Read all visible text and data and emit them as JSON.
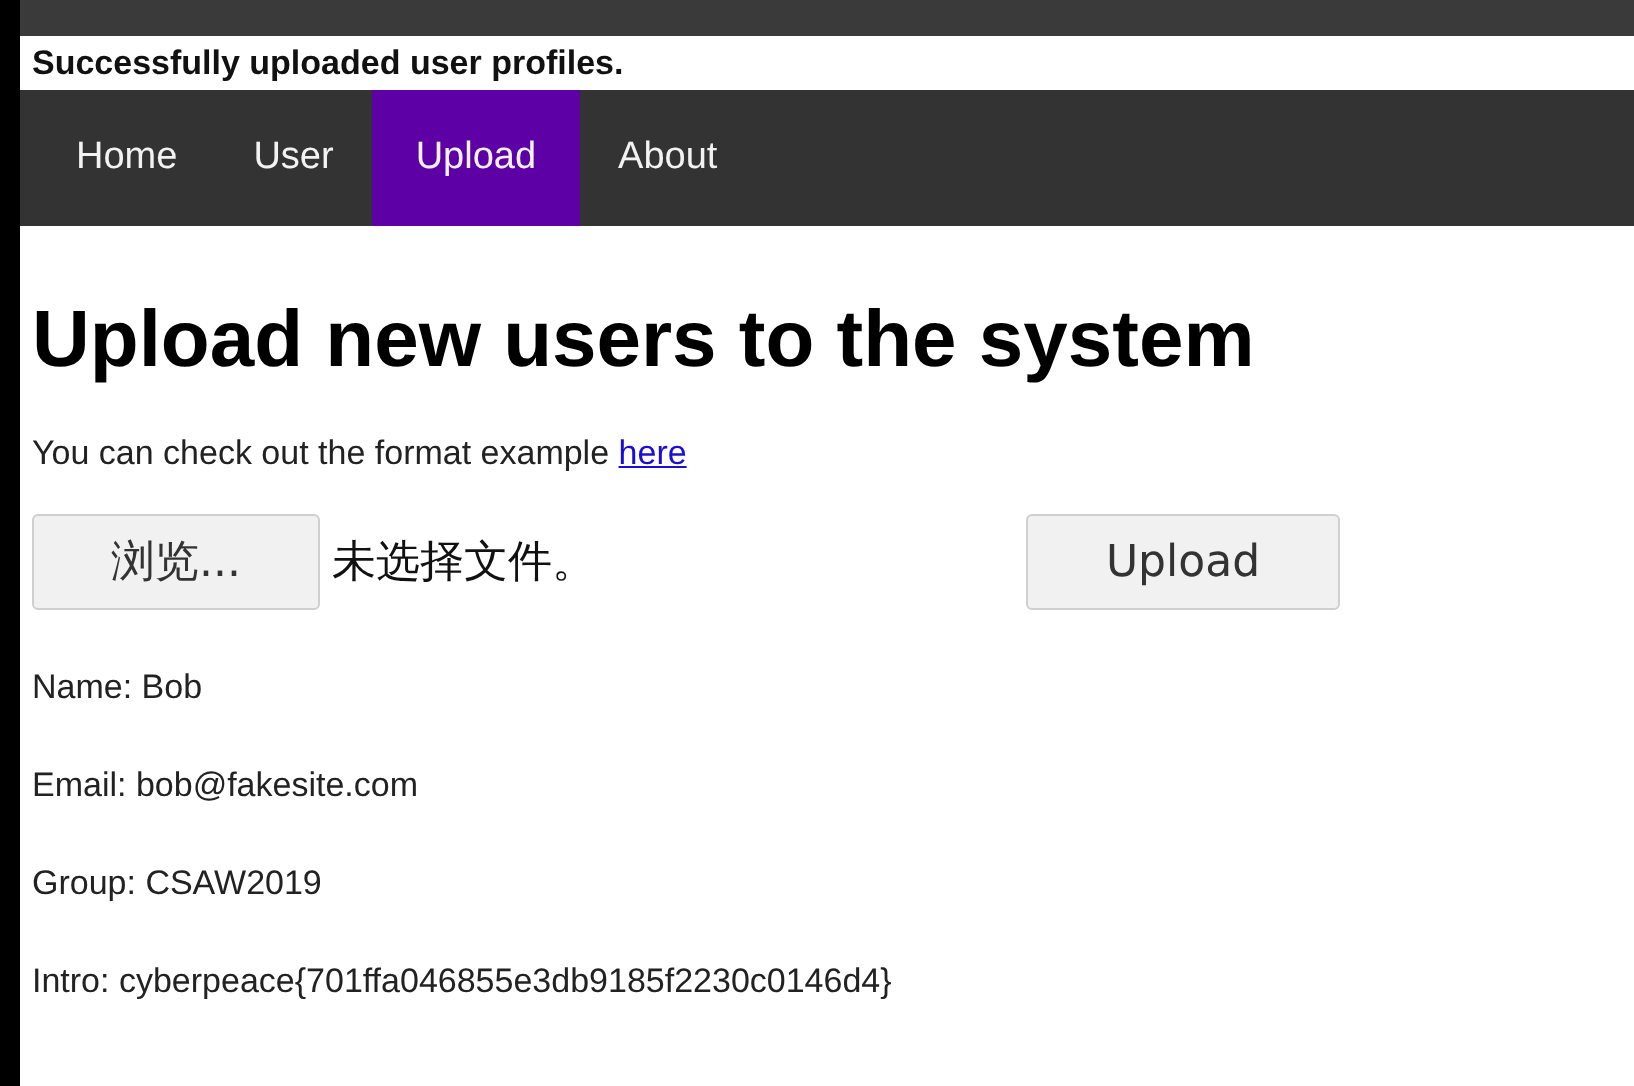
{
  "message": "Successfully uploaded user profiles.",
  "nav": [
    {
      "label": "Home",
      "selected": false
    },
    {
      "label": "User",
      "selected": false
    },
    {
      "label": "Upload",
      "selected": true
    },
    {
      "label": "About",
      "selected": false
    }
  ],
  "heading": "Upload new users to the system",
  "intro_text": {
    "text": "You can check out the format example",
    "link": "here"
  },
  "file_input": {
    "button": "浏览...",
    "status": "未选择文件。"
  },
  "upload_button": "Upload",
  "profile": [
    "Name: Bob",
    "Email: bob@fakesite.com",
    "Group: CSAW2019",
    "Intro: cyberpeace{701ffa046855e3db9185f2230c0146d4}"
  ]
}
